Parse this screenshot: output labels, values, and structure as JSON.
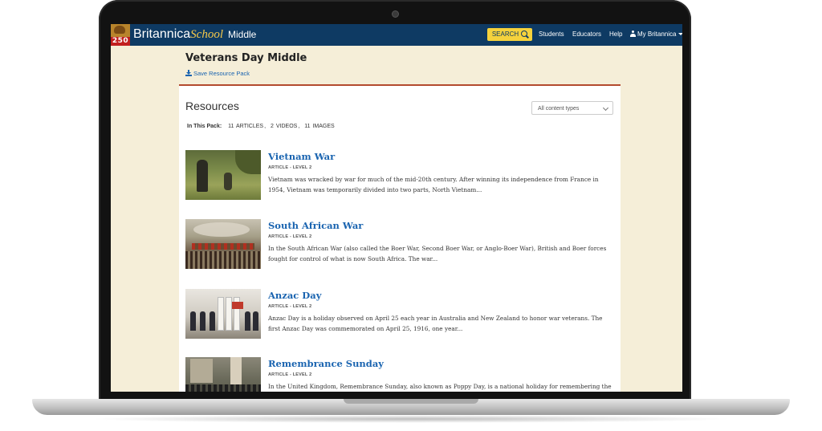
{
  "header": {
    "logo_badge": "250",
    "brand_name": "Britannica",
    "brand_school": "School",
    "brand_level": "Middle",
    "search_label": "SEARCH",
    "nav": [
      "Students",
      "Educators",
      "Help"
    ],
    "account_label": "My Britannica"
  },
  "page": {
    "title": "Veterans Day Middle",
    "save_label": "Save Resource Pack"
  },
  "resources": {
    "heading": "Resources",
    "filter_selected": "All content types",
    "pack_label": "In This Pack:",
    "pack_counts": [
      "11",
      "ARTICLES",
      "2",
      "VIDEOS",
      "11",
      "IMAGES"
    ]
  },
  "items": [
    {
      "title": "Vietnam War",
      "meta": "ARTICLE - LEVEL 2",
      "desc": "Vietnam was wracked by war for much of the mid-20th century. After winning its independence from France in 1954, Vietnam was temporarily divided into two parts, North Vietnam..."
    },
    {
      "title": "South African War",
      "meta": "ARTICLE - LEVEL 2",
      "desc": "In the South African War (also called the Boer War, Second Boer War, or Anglo-Boer War), British and Boer forces fought for control of what is now South Africa. The war..."
    },
    {
      "title": "Anzac Day",
      "meta": "ARTICLE - LEVEL 2",
      "desc": "Anzac Day is a holiday observed on April 25 each year in Australia and New Zealand to honor war veterans. The first Anzac Day was commemorated on April 25, 1916, one year..."
    },
    {
      "title": "Remembrance Sunday",
      "meta": "ARTICLE - LEVEL 2",
      "desc": "In the United Kingdom, Remembrance Sunday, also known as Poppy Day, is a national holiday for remembering the"
    }
  ],
  "colors": {
    "header_bg": "#0e3a63",
    "page_bg": "#f5eed8",
    "link": "#1a64b0",
    "search_bg": "#f5d23c",
    "panel_border": "#b34a2e"
  }
}
